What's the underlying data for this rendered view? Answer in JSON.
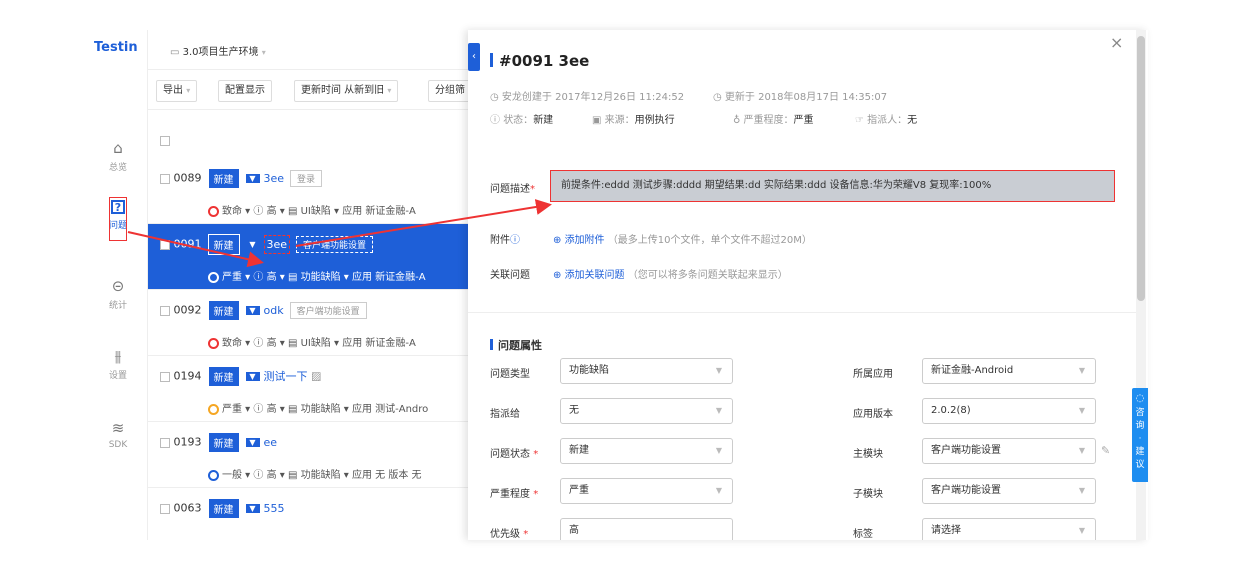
{
  "app": {
    "logo": "Testin"
  },
  "nav": [
    {
      "icon": "home-icon",
      "glyph": "⌂",
      "label": "总览"
    },
    {
      "icon": "issue-icon",
      "glyph": "?",
      "label": "问题"
    },
    {
      "icon": "stats-icon",
      "glyph": "⊝",
      "label": "统计"
    },
    {
      "icon": "settings-icon",
      "glyph": "⫵",
      "label": "设置"
    },
    {
      "icon": "sdk-icon",
      "glyph": "≋",
      "label": "SDK"
    }
  ],
  "project": {
    "name": "3.0项目生产环境"
  },
  "toolbar": {
    "export": "导出",
    "config": "配置显示",
    "sort": "更新时间 从新到旧",
    "group": "分组筛"
  },
  "issues": [
    {
      "id": "0089",
      "status": "新建",
      "title": "3ee",
      "module": "登录",
      "severity": "致命",
      "priority": "高",
      "type": "UI缺陷",
      "app": "应用 新证金融-A"
    },
    {
      "id": "0091",
      "status": "新建",
      "title": "3ee",
      "module": "客户端功能设置",
      "severity": "严重",
      "priority": "高",
      "type": "功能缺陷",
      "app": "应用 新证金融-A"
    },
    {
      "id": "0092",
      "status": "新建",
      "title": "odk",
      "module": "客户端功能设置",
      "severity": "致命",
      "priority": "高",
      "type": "UI缺陷",
      "app": "应用 新证金融-A"
    },
    {
      "id": "0194",
      "status": "新建",
      "title": "测试一下",
      "module": "",
      "severity": "严重",
      "priority": "高",
      "type": "功能缺陷",
      "app": "应用 测试-Andro"
    },
    {
      "id": "0193",
      "status": "新建",
      "title": "ee",
      "module": "",
      "severity": "一般",
      "priority": "高",
      "type": "功能缺陷",
      "app": "应用 无  版本 无"
    },
    {
      "id": "0063",
      "status": "新建",
      "title": "555",
      "module": "",
      "severity": "",
      "priority": "",
      "type": "",
      "app": ""
    }
  ],
  "detail": {
    "title": "#0091 3ee",
    "created": "安龙创建于 2017年12月26日 11:24:52",
    "updated": "更新于 2018年08月17日 14:35:07",
    "status_label": "状态：",
    "status": "新建",
    "source_label": "来源：",
    "source": "用例执行",
    "severity_label": "严重程度：",
    "severity": "严重",
    "assignee_label": "指派人：",
    "assignee": "无",
    "desc_label": "问题描述",
    "desc": "前提条件:eddd 测试步骤:dddd 期望结果:dd 实际结果:ddd 设备信息:华为荣耀V8 复现率:100%",
    "attach_label": "附件",
    "attach_link": "添加附件",
    "attach_hint": "（最多上传10个文件，单个文件不超过20M）",
    "related_label": "关联问题",
    "related_link": "添加关联问题",
    "related_hint": "（您可以将多条问题关联起来显示）",
    "props_title": "问题属性",
    "props_left": [
      {
        "label": "问题类型",
        "req": false,
        "value": "功能缺陷"
      },
      {
        "label": "指派给",
        "req": false,
        "value": "无"
      },
      {
        "label": "问题状态",
        "req": true,
        "value": "新建"
      },
      {
        "label": "严重程度",
        "req": true,
        "value": "严重"
      },
      {
        "label": "优先级",
        "req": true,
        "value": "高"
      }
    ],
    "props_right": [
      {
        "label": "所属应用",
        "value": "新证金融-Android"
      },
      {
        "label": "应用版本",
        "value": "2.0.2(8)"
      },
      {
        "label": "主模块",
        "value": "客户端功能设置"
      },
      {
        "label": "子模块",
        "value": "客户端功能设置"
      },
      {
        "label": "标签",
        "value": "请选择"
      }
    ]
  },
  "consult": {
    "label": "咨询·建议"
  },
  "colors": {
    "accent": "#1e5fd8",
    "annotation": "#e33333"
  }
}
